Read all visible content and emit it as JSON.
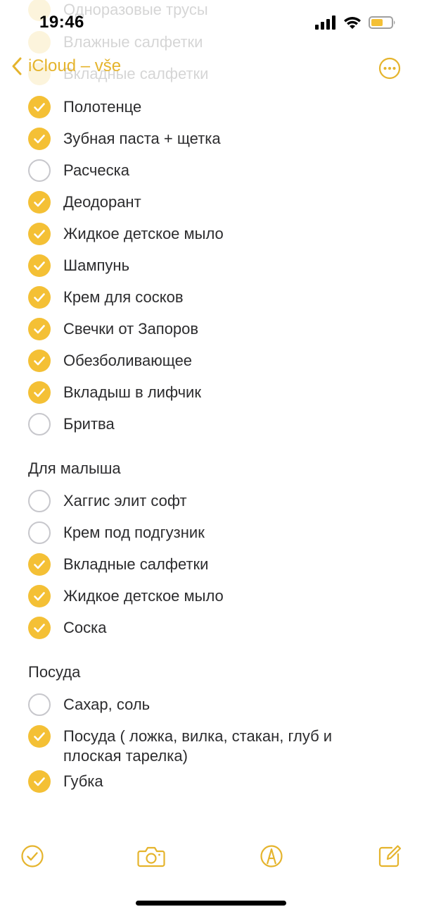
{
  "status": {
    "time": "19:46",
    "icons": [
      "signal-icon",
      "wifi-icon",
      "battery-icon"
    ],
    "battery_color": "#f4c035"
  },
  "ghost": {
    "rows": [
      "Одноразовые трусы",
      "Влажные салфетки",
      "Вкладные салфетки"
    ]
  },
  "nav": {
    "back_label": "iCloud – vše",
    "back_icon": "chevron-left-icon",
    "more_icon": "more-icon"
  },
  "accent_color": "#e5b42d",
  "lists": {
    "top_items": [
      {
        "label": "Полотенце",
        "checked": true
      },
      {
        "label": "Зубная паста + щетка",
        "checked": true
      },
      {
        "label": "Расческа",
        "checked": false
      },
      {
        "label": "Деодорант",
        "checked": true
      },
      {
        "label": "Жидкое детское мыло",
        "checked": true
      },
      {
        "label": "Шампунь",
        "checked": true
      },
      {
        "label": "Крем для сосков",
        "checked": true
      },
      {
        "label": "Свечки от Запоров",
        "checked": true
      },
      {
        "label": "Обезболивающее",
        "checked": true
      },
      {
        "label": "Вкладыш в лифчик",
        "checked": true
      },
      {
        "label": "Бритва",
        "checked": false
      }
    ],
    "baby_title": "Для малыша",
    "baby_items": [
      {
        "label": "Хаггис элит софт",
        "checked": false
      },
      {
        "label": "Крем под подгузник",
        "checked": false
      },
      {
        "label": "Вкладные салфетки",
        "checked": true
      },
      {
        "label": "Жидкое детское мыло",
        "checked": true
      },
      {
        "label": "Соска",
        "checked": true
      }
    ],
    "dishes_title": "Посуда",
    "dishes_items": [
      {
        "label": "Сахар, соль",
        "checked": false
      },
      {
        "label": "Посуда ( ложка, вилка, стакан, глуб и плоская тарелка)",
        "checked": true
      },
      {
        "label": "Губка",
        "checked": true
      }
    ]
  },
  "toolbar": {
    "icons": [
      "checklist-icon",
      "camera-icon",
      "markup-icon",
      "compose-icon"
    ]
  }
}
